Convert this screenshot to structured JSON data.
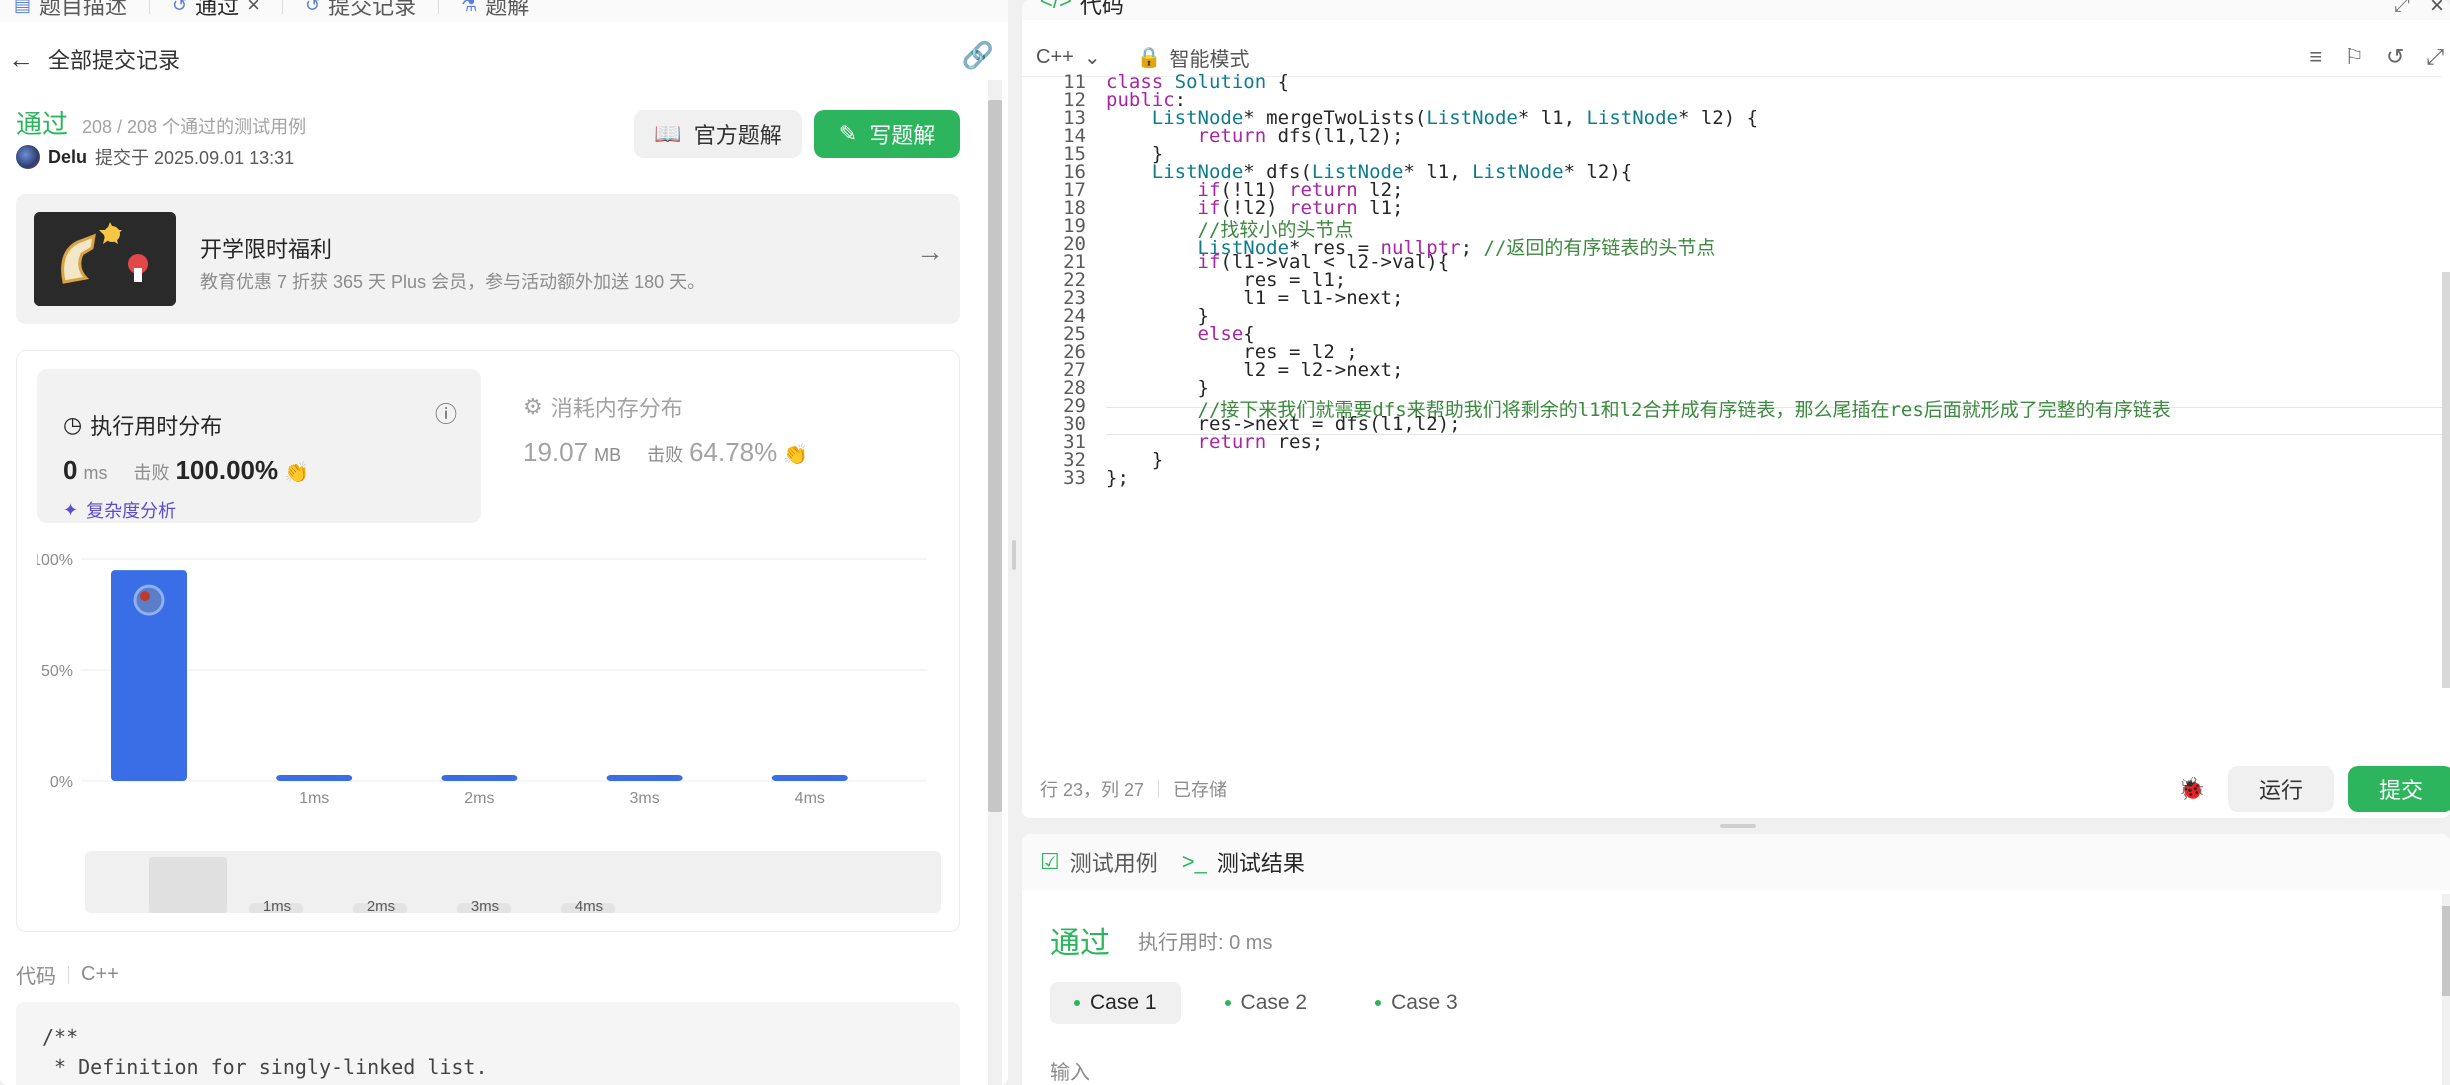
{
  "tabs": [
    {
      "label": "题目描述",
      "icon": "document-icon"
    },
    {
      "label": "通过",
      "icon": "history-icon"
    },
    {
      "label": "提交记录",
      "icon": "history-icon"
    },
    {
      "label": "题解",
      "icon": "flask-icon"
    }
  ],
  "topbar": {
    "back_label": "全部提交记录"
  },
  "submission": {
    "status": "通过",
    "testcases": "208 / 208 个通过的测试用例",
    "author": "Delu",
    "submitted_at": "提交于 2025.09.01 13:31",
    "official_btn": "官方题解",
    "write_btn": "写题解"
  },
  "promo": {
    "title": "开学限时福利",
    "desc": "教育优惠 7 折获 365 天 Plus 会员，参与活动额外加送 180 天。"
  },
  "runtime": {
    "title": "执行用时分布",
    "value": "0",
    "unit": "ms",
    "beat_label": "击败",
    "beat_value": "100.00%",
    "complexity": "复杂度分析"
  },
  "memory": {
    "title": "消耗内存分布",
    "value": "19.07",
    "unit": "MB",
    "beat_label": "击败",
    "beat_value": "64.78%"
  },
  "chart_data": {
    "type": "bar",
    "categories": [
      "",
      "1ms",
      "2ms",
      "3ms",
      "4ms"
    ],
    "values": [
      95,
      2,
      2,
      2,
      2
    ],
    "yticks": [
      "100%",
      "50%",
      "0%"
    ],
    "ylim": [
      0,
      100
    ],
    "minimap_labels": [
      "1ms",
      "2ms",
      "3ms",
      "4ms"
    ],
    "colors": {
      "bar": "#3a6ee6",
      "grid": "#ececec"
    }
  },
  "code_label": {
    "left": "代码",
    "right": "C++"
  },
  "code_preview": [
    "/**",
    " * Definition for singly-linked list."
  ],
  "editor": {
    "title": "代码",
    "language": "C++",
    "mode": "智能模式",
    "status_pos": "行 23，列 27",
    "status_saved": "已存储",
    "run": "运行",
    "submit": "提交"
  },
  "code_lines": [
    {
      "n": "11",
      "text": "class Solution {"
    },
    {
      "n": "12",
      "text": "public:"
    },
    {
      "n": "13",
      "text": "    ListNode* mergeTwoLists(ListNode* l1, ListNode* l2) {"
    },
    {
      "n": "14",
      "text": "        return dfs(l1,l2);"
    },
    {
      "n": "15",
      "text": "    }"
    },
    {
      "n": "16",
      "text": "    ListNode* dfs(ListNode* l1, ListNode* l2){"
    },
    {
      "n": "17",
      "text": "        if(!l1) return l2;"
    },
    {
      "n": "18",
      "text": "        if(!l2) return l1;"
    },
    {
      "n": "19",
      "text": "        //找较小的头节点"
    },
    {
      "n": "20",
      "text": "        ListNode* res = nullptr; //返回的有序链表的头节点"
    },
    {
      "n": "21",
      "text": "        if(l1->val < l2->val){"
    },
    {
      "n": "22",
      "text": "            res = l1;"
    },
    {
      "n": "23",
      "text": "            l1 = l1->next;"
    },
    {
      "n": "24",
      "text": "        }"
    },
    {
      "n": "25",
      "text": "        else{"
    },
    {
      "n": "26",
      "text": "            res = l2 ;"
    },
    {
      "n": "27",
      "text": "            l2 = l2->next;"
    },
    {
      "n": "28",
      "text": "        }"
    },
    {
      "n": "29",
      "text": "        //接下来我们就需要dfs来帮助我们将剩余的l1和l2合并成有序链表，那么尾插在res后面就形成了完整的有序链表"
    },
    {
      "n": "30",
      "text": "        res->next = dfs(l1,l2);"
    },
    {
      "n": "31",
      "text": "        return res;"
    },
    {
      "n": "32",
      "text": "    }"
    },
    {
      "n": "33",
      "text": "};"
    }
  ],
  "result": {
    "tab_testcase": "测试用例",
    "tab_result": "测试结果",
    "status": "通过",
    "time": "执行用时: 0 ms",
    "cases": [
      "Case 1",
      "Case 2",
      "Case 3"
    ],
    "input_label": "输入"
  }
}
